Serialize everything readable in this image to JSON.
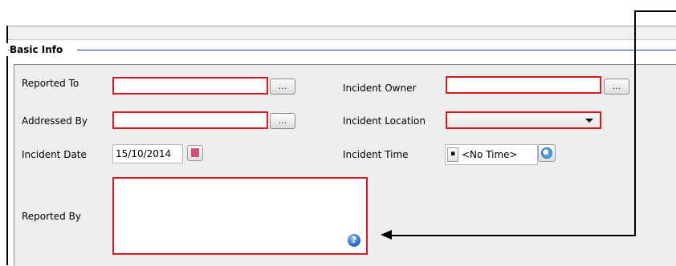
{
  "section": {
    "title": "Basic Info"
  },
  "fields": {
    "reported_to": {
      "label": "Reported To",
      "value": "",
      "button_label": "..."
    },
    "addressed_by": {
      "label": "Addressed By",
      "value": "",
      "button_label": "..."
    },
    "incident_date": {
      "label": "Incident Date",
      "value": "15/10/2014",
      "icon": "calendar-icon"
    },
    "reported_by": {
      "label": "Reported By",
      "value": "",
      "help_icon": "help-icon"
    },
    "incident_owner": {
      "label": "Incident Owner",
      "value": "",
      "button_label": "..."
    },
    "incident_location": {
      "label": "Incident Location",
      "selected": ""
    },
    "incident_time": {
      "label": "Incident Time",
      "value": "<No Time>",
      "icon": "clock-icon"
    }
  },
  "colors": {
    "required_border": "#e0151d",
    "section_line": "#1a3fb0",
    "panel_bg": "#eeeeee"
  }
}
